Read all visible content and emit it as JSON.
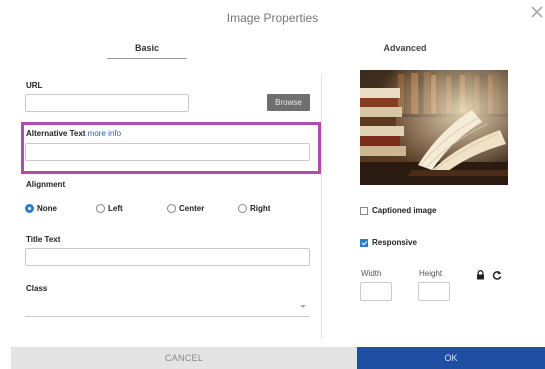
{
  "dialog": {
    "title": "Image Properties",
    "close_icon": "close-icon"
  },
  "tabs": [
    {
      "label": "Basic",
      "active": true
    },
    {
      "label": "Advanced",
      "active": false
    }
  ],
  "basic": {
    "url_label": "URL",
    "url_value": "",
    "browse_label": "Browse",
    "alt_label": "Alternative Text",
    "alt_more_info": "more info",
    "alt_value": "",
    "alignment_label": "Alignment",
    "alignment_options": [
      {
        "label": "None",
        "checked": true
      },
      {
        "label": "Left",
        "checked": false
      },
      {
        "label": "Center",
        "checked": false
      },
      {
        "label": "Right",
        "checked": false
      }
    ],
    "title_text_label": "Title Text",
    "title_text_value": "",
    "class_label": "Class",
    "class_value": ""
  },
  "preview": {
    "captioned_label": "Captioned image",
    "captioned_checked": false,
    "responsive_label": "Responsive",
    "responsive_checked": true,
    "width_label": "Width",
    "height_label": "Height",
    "width_value": "",
    "height_value": "",
    "lock_icon": "lock-icon",
    "reset_icon": "refresh-icon"
  },
  "footer": {
    "cancel_label": "CANCEL",
    "ok_label": "OK"
  },
  "colors": {
    "accent": "#1e4fa2",
    "highlight": "#b24cab",
    "link": "#1e64b4"
  }
}
